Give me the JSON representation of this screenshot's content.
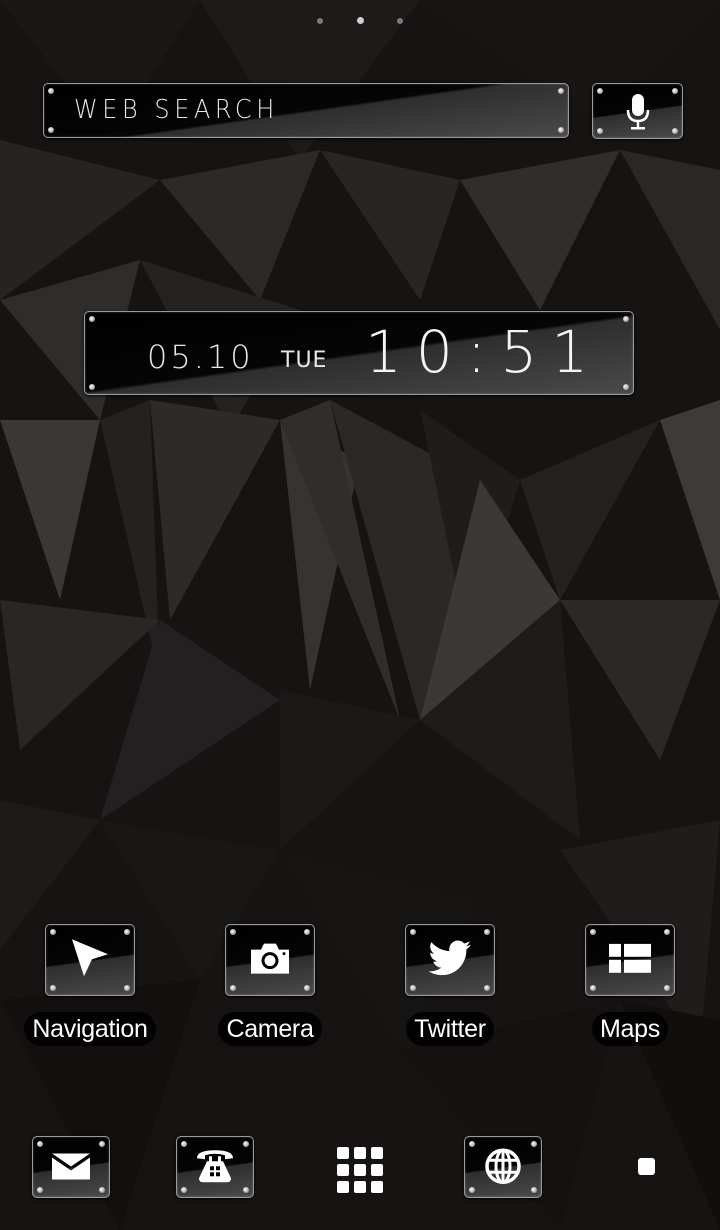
{
  "page_indicator": {
    "count": 3,
    "active_index": 1
  },
  "search": {
    "label": "WEB SEARCH",
    "icon": "mic-icon"
  },
  "clock": {
    "date": "05.10",
    "day_of_week": "TUE",
    "time": "10:51"
  },
  "apps": [
    {
      "label": "Navigation",
      "icon": "navigation-arrow-icon"
    },
    {
      "label": "Camera",
      "icon": "camera-icon"
    },
    {
      "label": "Twitter",
      "icon": "twitter-bird-icon"
    },
    {
      "label": "Maps",
      "icon": "maps-grid-icon"
    }
  ],
  "dock": [
    {
      "name": "mail",
      "icon": "envelope-icon"
    },
    {
      "name": "phone",
      "icon": "telephone-icon"
    },
    {
      "name": "app-drawer",
      "icon": "grid-icon"
    },
    {
      "name": "browser",
      "icon": "globe-icon"
    },
    {
      "name": "recents",
      "icon": "square-icon"
    }
  ],
  "colors": {
    "background": "#141110",
    "plate_border": "#9a9a9a",
    "text": "#ffffff"
  }
}
